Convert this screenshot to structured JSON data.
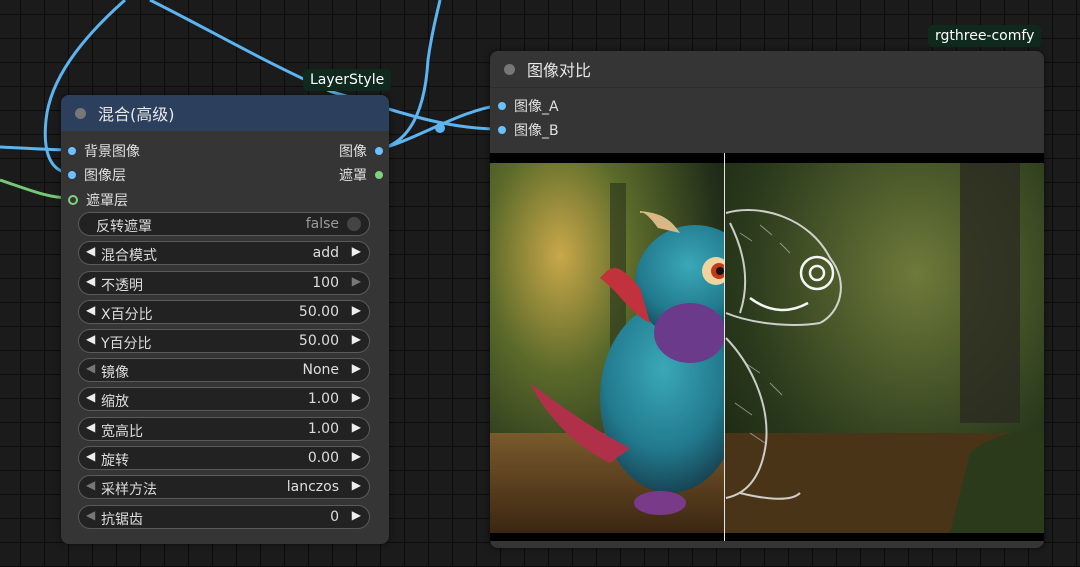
{
  "tags": {
    "layerstyle": "LayerStyle",
    "rgthree": "rgthree-comfy"
  },
  "blend_node": {
    "title": "混合(高级)",
    "inputs": [
      "背景图像",
      "图像层",
      "遮罩层"
    ],
    "outputs": [
      "图像",
      "遮罩"
    ],
    "toggle": {
      "label": "反转遮罩",
      "value": "false"
    },
    "widgets": [
      {
        "label": "混合模式",
        "value": "add"
      },
      {
        "label": "不透明",
        "value": "100"
      },
      {
        "label": "X百分比",
        "value": "50.00"
      },
      {
        "label": "Y百分比",
        "value": "50.00"
      },
      {
        "label": "镜像",
        "value": "None"
      },
      {
        "label": "缩放",
        "value": "1.00"
      },
      {
        "label": "宽高比",
        "value": "1.00"
      },
      {
        "label": "旋转",
        "value": "0.00"
      },
      {
        "label": "采样方法",
        "value": "lanczos"
      },
      {
        "label": "抗锯齿",
        "value": "0"
      }
    ]
  },
  "compare_node": {
    "title": "图像对比",
    "inputs": [
      "图像_A",
      "图像_B"
    ]
  },
  "colors": {
    "image_wire": "#5cb4f0",
    "mask_wire": "#74c874",
    "blend_header": "#2c3f5d",
    "node_body": "#353535",
    "tag_bg": "#0f2a1d"
  }
}
